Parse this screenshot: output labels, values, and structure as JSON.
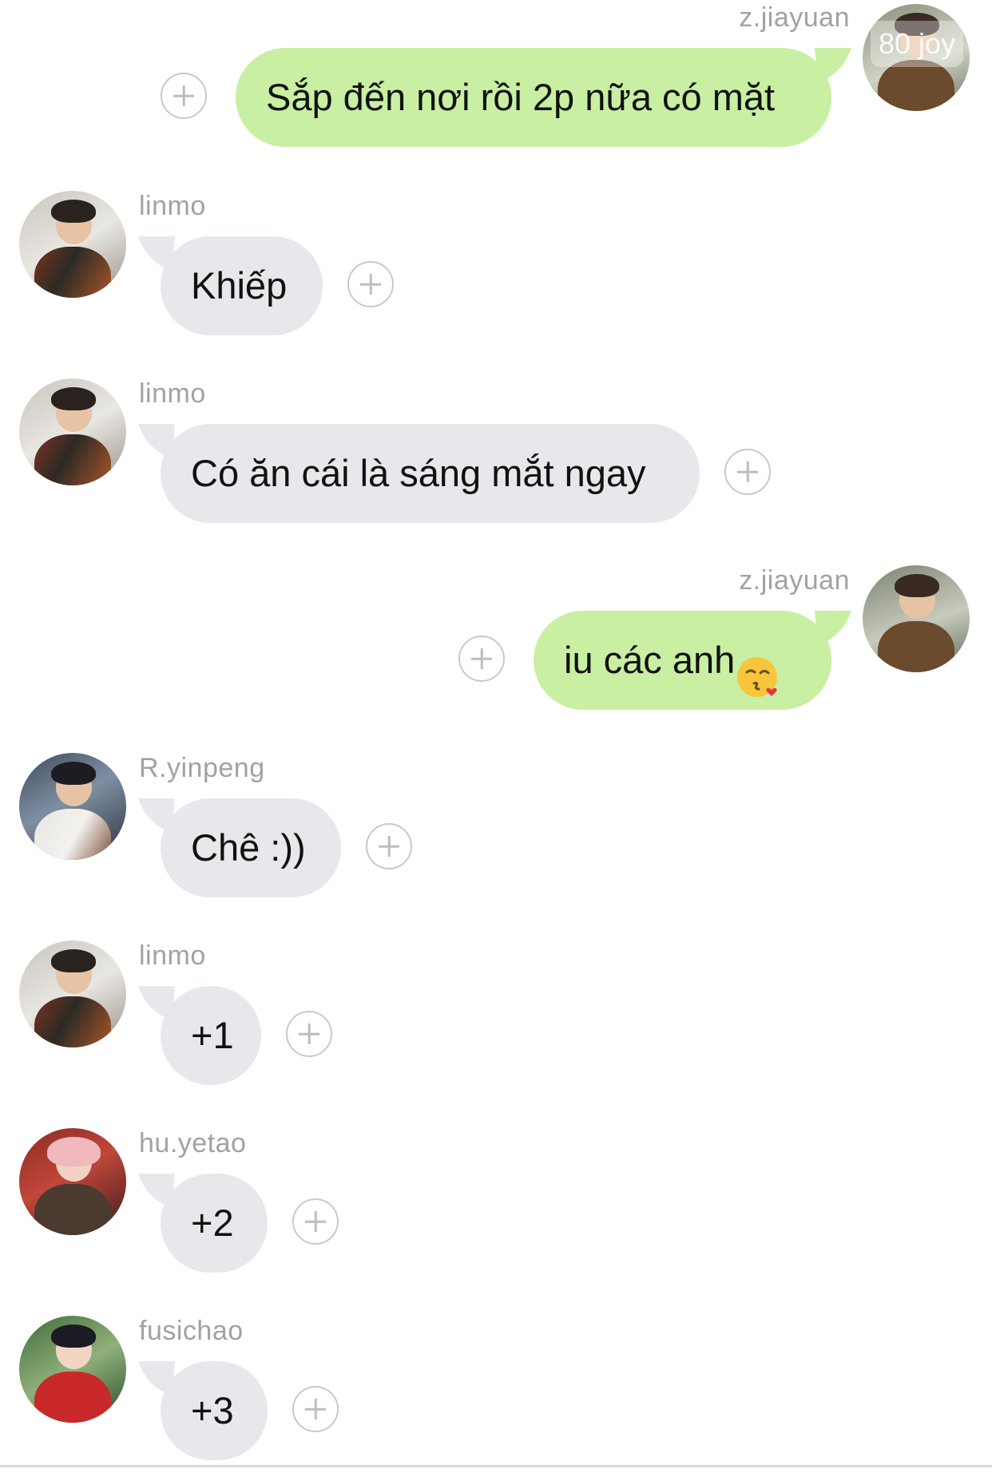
{
  "watermark": "80 joy",
  "messages": [
    {
      "direction": "outgoing",
      "sender": "z.jiayuan",
      "text": "Sắp đến nơi rồi 2p nữa có mặt"
    },
    {
      "direction": "incoming",
      "sender": "linmo",
      "text": "Khiếp"
    },
    {
      "direction": "incoming",
      "sender": "linmo",
      "text": "Có ăn cái là sáng mắt ngay"
    },
    {
      "direction": "outgoing",
      "sender": "z.jiayuan",
      "text": "iu các anh",
      "emoji": "kissing-face-with-heart-emoji"
    },
    {
      "direction": "incoming",
      "sender": "R.yinpeng",
      "text": "Chê :))"
    },
    {
      "direction": "incoming",
      "sender": "linmo",
      "text": "+1"
    },
    {
      "direction": "incoming",
      "sender": "hu.yetao",
      "text": "+2"
    },
    {
      "direction": "incoming",
      "sender": "fusichao",
      "text": "+3"
    }
  ],
  "colors": {
    "incoming_bubble": "#e6e8ec",
    "outgoing_bubble": "#c8efa2",
    "name_text": "#a2a2a2",
    "plus_icon": "#c9c9c9"
  }
}
